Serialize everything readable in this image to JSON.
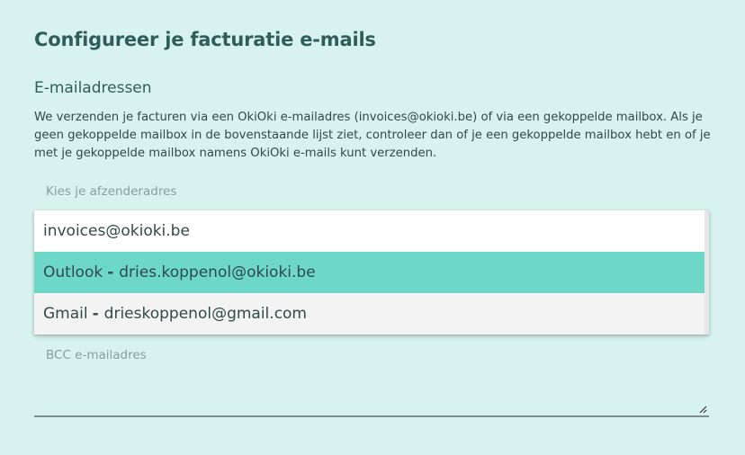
{
  "header": {
    "title": "Configureer je facturatie e-mails"
  },
  "section": {
    "title": "E-mailadressen",
    "description": "We verzenden je facturen via een OkiOki e-mailadres (invoices@okioki.be) of via een gekoppelde mailbox. Als je geen gekoppelde mailbox in de bovenstaande lijst ziet, controleer dan of je een gekoppelde mailbox hebt en of je met je gekoppelde mailbox namens OkiOki e-mails kunt verzenden."
  },
  "sender": {
    "label": "Kies je afzenderadres",
    "options": [
      {
        "provider": "",
        "separator": "",
        "email": "invoices@okioki.be"
      },
      {
        "provider": "Outlook",
        "separator": "-",
        "email": "dries.koppenol@okioki.be",
        "highlighted": true
      },
      {
        "provider": "Gmail",
        "separator": "-",
        "email": "drieskoppenol@gmail.com"
      }
    ]
  },
  "bcc": {
    "label": "BCC e-mailadres",
    "value": ""
  },
  "colors": {
    "background": "#d8f3ef",
    "highlight": "#6dd8c8",
    "title": "#2f5e59"
  },
  "icons": {
    "resize": "resize-grip-icon"
  }
}
